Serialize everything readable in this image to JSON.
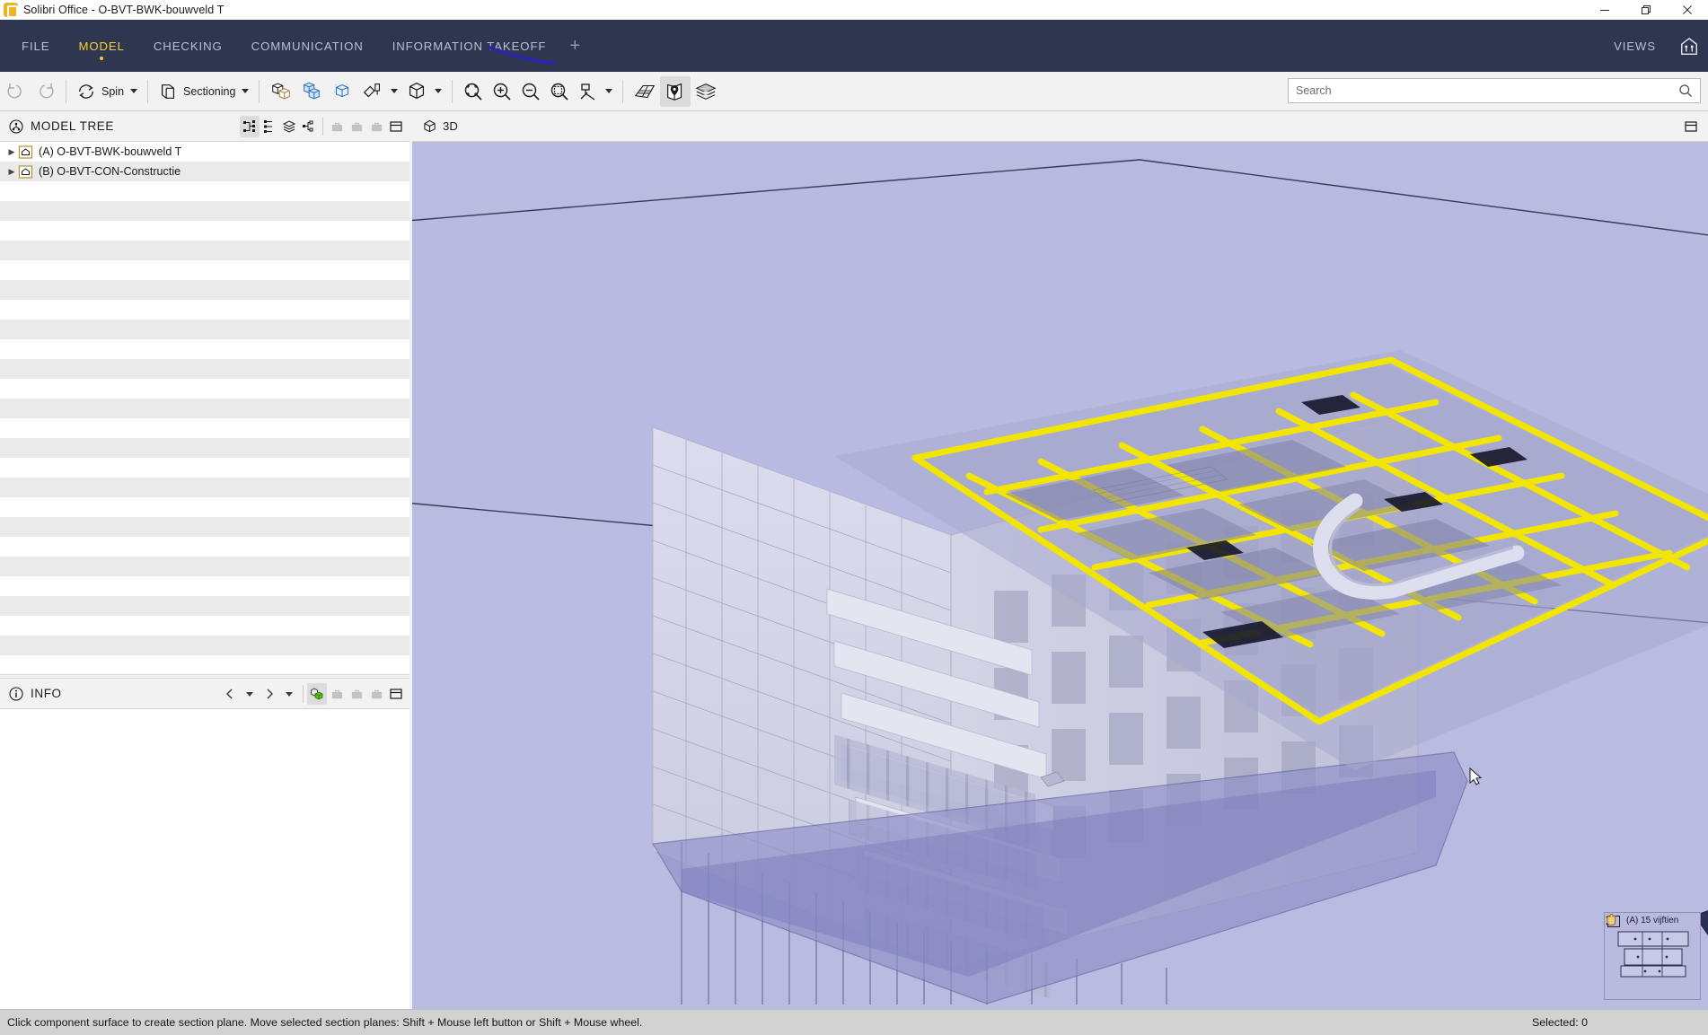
{
  "window": {
    "title": "Solibri Office - O-BVT-BWK-bouwveld T",
    "app_icon": "solibri-logo-icon",
    "controls": {
      "minimize": "minimize-icon",
      "restore": "restore-icon",
      "close": "close-icon"
    }
  },
  "menubar": {
    "items": [
      {
        "label": "FILE",
        "active": false
      },
      {
        "label": "MODEL",
        "active": true
      },
      {
        "label": "CHECKING",
        "active": false
      },
      {
        "label": "COMMUNICATION",
        "active": false
      },
      {
        "label": "INFORMATION TAKEOFF",
        "active": false
      }
    ],
    "add_tab": "+",
    "views_label": "VIEWS",
    "views_logo": "solibri-views-icon",
    "accent_color": "#f5cd38",
    "background_color": "#2f3750"
  },
  "toolbar": {
    "undo": "undo-icon",
    "redo": "redo-icon",
    "spin_label": "Spin",
    "sectioning_label": "Sectioning",
    "buttons": [
      "transparent-components-icon",
      "show-hide-components-icon",
      "show-only-selected-icon",
      "paint-components-icon",
      "component-view-icon",
      "zoom-selected-icon",
      "zoom-in-icon",
      "zoom-out-icon",
      "zoom-area-icon",
      "measure-icon",
      "walk-floor-icon",
      "section-plane-icon",
      "layers-icon"
    ],
    "active_button": "section-plane-icon"
  },
  "search": {
    "placeholder": "Search",
    "value": "",
    "icon": "search-icon"
  },
  "model_tree": {
    "icon": "model-tree-icon",
    "title": "MODEL TREE",
    "tools": [
      {
        "name": "hierarchy-view-icon",
        "selected": true,
        "dim": false
      },
      {
        "name": "flat-list-icon",
        "selected": false,
        "dim": false
      },
      {
        "name": "layered-view-icon",
        "selected": false,
        "dim": false
      },
      {
        "name": "grouped-view-icon",
        "selected": false,
        "dim": false
      },
      {
        "name": "briefcase-1-icon",
        "selected": false,
        "dim": true
      },
      {
        "name": "briefcase-2-icon",
        "selected": false,
        "dim": true
      },
      {
        "name": "briefcase-3-icon",
        "selected": false,
        "dim": true
      },
      {
        "name": "panel-layout-icon",
        "selected": false,
        "dim": false
      }
    ],
    "rows": [
      {
        "label": "(A) O-BVT-BWK-bouwveld T",
        "icon": "model-file-icon",
        "expandable": true
      },
      {
        "label": "(B) O-BVT-CON-Constructie",
        "icon": "model-file-icon",
        "expandable": true
      }
    ]
  },
  "info_panel": {
    "icon": "info-icon",
    "title": "INFO",
    "tools": [
      {
        "name": "previous-arrow-icon",
        "selected": false,
        "dim": false
      },
      {
        "name": "previous-dropdown-icon",
        "selected": false,
        "dim": false
      },
      {
        "name": "next-arrow-icon",
        "selected": false,
        "dim": false
      },
      {
        "name": "next-dropdown-icon",
        "selected": false,
        "dim": false
      },
      {
        "name": "component-info-icon",
        "selected": true,
        "dim": false
      },
      {
        "name": "briefcase-1-icon",
        "selected": false,
        "dim": true
      },
      {
        "name": "briefcase-2-icon",
        "selected": false,
        "dim": true
      },
      {
        "name": "briefcase-3-icon",
        "selected": false,
        "dim": true
      },
      {
        "name": "panel-layout-icon",
        "selected": false,
        "dim": false
      }
    ]
  },
  "view_3d": {
    "icon": "cube-3d-icon",
    "title": "3D",
    "layout_icon": "panel-layout-icon",
    "background_color": "#babbe0",
    "section_plane_color": "#b7b8e0",
    "highlight_color": "#f3e900",
    "building_color": "#d9daec"
  },
  "preview": {
    "label": "(A) 15 vijftien",
    "flag_icon": "view-flag-icon",
    "close_icon": "close-icon",
    "plan_icon": "floor-plan-thumbnail",
    "cursor_icon": "hand-cursor-icon"
  },
  "statusbar": {
    "message": "Click component surface to create section plane. Move selected section planes: Shift + Mouse left button or Shift + Mouse wheel.",
    "selected_label": "Selected: 0"
  }
}
